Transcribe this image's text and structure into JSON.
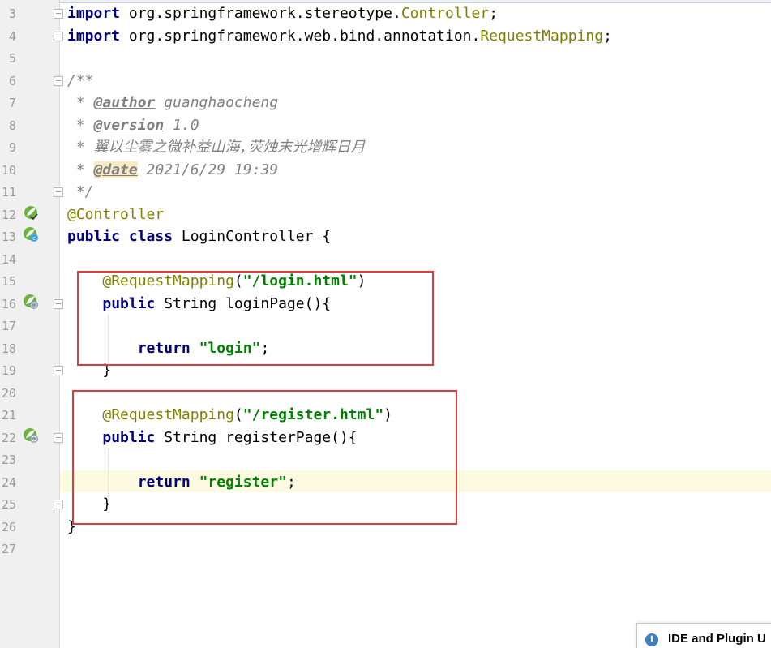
{
  "editor": {
    "lines": [
      {
        "no": "3",
        "tokens": [
          {
            "t": "import",
            "c": "kw"
          },
          {
            "t": " org.springframework.stereotype.",
            "c": ""
          },
          {
            "t": "Controller",
            "c": "ann"
          },
          {
            "t": ";",
            "c": ""
          }
        ]
      },
      {
        "no": "4",
        "tokens": [
          {
            "t": "import",
            "c": "kw"
          },
          {
            "t": " org.springframework.web.bind.annotation.",
            "c": ""
          },
          {
            "t": "RequestMapping",
            "c": "ann"
          },
          {
            "t": ";",
            "c": ""
          }
        ]
      },
      {
        "no": "5",
        "tokens": []
      },
      {
        "no": "6",
        "tokens": [
          {
            "t": "/**",
            "c": "cmt"
          }
        ]
      },
      {
        "no": "7",
        "tokens": [
          {
            "t": " * ",
            "c": "cmt"
          },
          {
            "t": "@author",
            "c": "tag"
          },
          {
            "t": " guanghaocheng",
            "c": "cmt"
          }
        ]
      },
      {
        "no": "8",
        "tokens": [
          {
            "t": " * ",
            "c": "cmt"
          },
          {
            "t": "@version",
            "c": "tag"
          },
          {
            "t": " 1.0",
            "c": "cmt"
          }
        ]
      },
      {
        "no": "9",
        "tokens": [
          {
            "t": " * 翼以尘雾之微补益山海,荧烛末光增辉日月",
            "c": "cmt"
          }
        ]
      },
      {
        "no": "10",
        "tokens": [
          {
            "t": " * ",
            "c": "cmt"
          },
          {
            "t": "@date",
            "c": "tag hl"
          },
          {
            "t": " 2021/6/29 19:39",
            "c": "cmt"
          }
        ]
      },
      {
        "no": "11",
        "tokens": [
          {
            "t": " */",
            "c": "cmt"
          }
        ]
      },
      {
        "no": "12",
        "tokens": [
          {
            "t": "@Controller",
            "c": "ann"
          }
        ]
      },
      {
        "no": "13",
        "tokens": [
          {
            "t": "public class",
            "c": "kw"
          },
          {
            "t": " LoginController {",
            "c": ""
          }
        ]
      },
      {
        "no": "14",
        "tokens": []
      },
      {
        "no": "15",
        "tokens": [
          {
            "t": "    ",
            "c": ""
          },
          {
            "t": "@RequestMapping",
            "c": "ann"
          },
          {
            "t": "(",
            "c": ""
          },
          {
            "t": "\"/login.html\"",
            "c": "str"
          },
          {
            "t": ")",
            "c": ""
          }
        ]
      },
      {
        "no": "16",
        "tokens": [
          {
            "t": "    ",
            "c": ""
          },
          {
            "t": "public",
            "c": "kw"
          },
          {
            "t": " String loginPage(){",
            "c": ""
          }
        ]
      },
      {
        "no": "17",
        "tokens": []
      },
      {
        "no": "18",
        "tokens": [
          {
            "t": "        ",
            "c": ""
          },
          {
            "t": "return",
            "c": "kw"
          },
          {
            "t": " ",
            "c": ""
          },
          {
            "t": "\"login\"",
            "c": "str"
          },
          {
            "t": ";",
            "c": ""
          }
        ]
      },
      {
        "no": "19",
        "tokens": [
          {
            "t": "    }",
            "c": ""
          }
        ]
      },
      {
        "no": "20",
        "tokens": []
      },
      {
        "no": "21",
        "tokens": [
          {
            "t": "    ",
            "c": ""
          },
          {
            "t": "@RequestMapping",
            "c": "ann"
          },
          {
            "t": "(",
            "c": ""
          },
          {
            "t": "\"/register.html\"",
            "c": "str"
          },
          {
            "t": ")",
            "c": ""
          }
        ]
      },
      {
        "no": "22",
        "tokens": [
          {
            "t": "    ",
            "c": ""
          },
          {
            "t": "public",
            "c": "kw"
          },
          {
            "t": " String registerPage(){",
            "c": ""
          }
        ]
      },
      {
        "no": "23",
        "tokens": []
      },
      {
        "no": "24",
        "tokens": [
          {
            "t": "        ",
            "c": ""
          },
          {
            "t": "return",
            "c": "kw"
          },
          {
            "t": " ",
            "c": ""
          },
          {
            "t": "\"register\"",
            "c": "str"
          },
          {
            "t": ";",
            "c": ""
          }
        ]
      },
      {
        "no": "25",
        "tokens": [
          {
            "t": "    }",
            "c": ""
          }
        ]
      },
      {
        "no": "26",
        "tokens": [
          {
            "t": "}",
            "c": ""
          }
        ]
      },
      {
        "no": "27",
        "tokens": []
      }
    ],
    "current_line": "24",
    "gutter_icons": [
      {
        "line": "12",
        "icon": "spring-bean-icon"
      },
      {
        "line": "13",
        "icon": "spring-controller-icon"
      },
      {
        "line": "16",
        "icon": "request-mapping-icon"
      },
      {
        "line": "22",
        "icon": "request-mapping-icon"
      }
    ],
    "fold_markers": [
      "3",
      "4",
      "6",
      "11",
      "16",
      "19",
      "22",
      "25"
    ]
  },
  "notification": {
    "icon": "info-icon",
    "text": "IDE and Plugin U"
  },
  "colors": {
    "keyword": "#000080",
    "annotation": "#808000",
    "string": "#008000",
    "comment": "#808080",
    "highlight_box": "#e03a3e",
    "current_line": "#fcfae1"
  }
}
